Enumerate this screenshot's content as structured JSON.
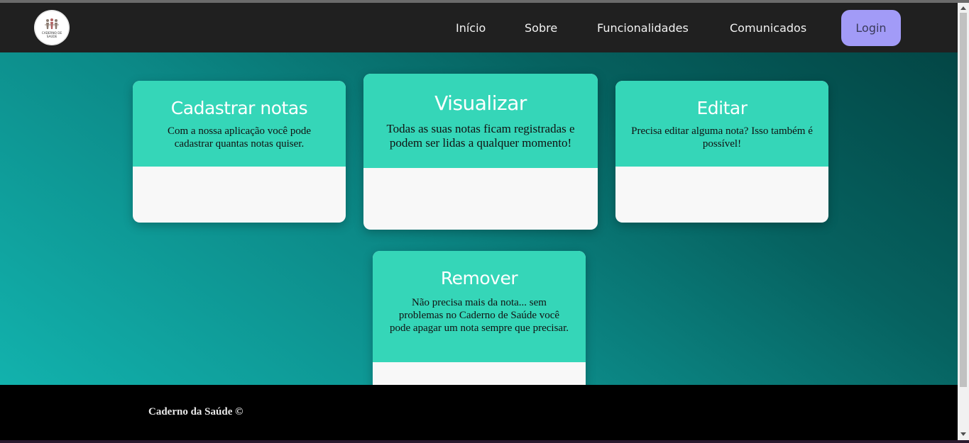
{
  "brand": {
    "logo_text_line1": "CADERNO DE",
    "logo_text_line2": "SAÚDE"
  },
  "nav": {
    "items": [
      {
        "label": "Início"
      },
      {
        "label": "Sobre"
      },
      {
        "label": "Funcionalidades"
      },
      {
        "label": "Comunicados"
      }
    ],
    "login_label": "Login"
  },
  "cards": [
    {
      "title": "Cadastrar notas",
      "text": "Com a nossa aplicação você pode cadastrar quantas notas quiser."
    },
    {
      "title": "Visualizar",
      "text": "Todas as suas notas ficam registradas e podem ser lidas a qualquer momento!"
    },
    {
      "title": "Editar",
      "text": "Precisa editar alguma nota? Isso também é possível!"
    },
    {
      "title": "Remover",
      "text": "Não precisa mais da nota... sem problemas no Caderno de Saúde você pode apagar um nota sempre que precisar."
    }
  ],
  "footer": {
    "text": "Caderno da Saúde ©"
  },
  "colors": {
    "navbar": "#202020",
    "accent_card": "#35d6b8",
    "login_button": "#a29bf7",
    "footer": "#000000"
  }
}
